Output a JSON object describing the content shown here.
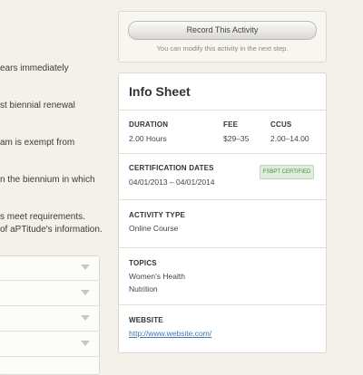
{
  "left": {
    "text_lines": [
      "ears immediately",
      "st biennial renewal",
      "am is exempt from",
      "n the biennium in which",
      "s meet requirements.",
      " of aPTitude's information."
    ]
  },
  "record": {
    "button_label": "Record This Activity",
    "note": "You can modify this activity in the next step."
  },
  "info": {
    "title": "Info Sheet",
    "duration_label": "DURATION",
    "duration_value": "2.00 Hours",
    "fee_label": "FEE",
    "fee_value": "$29–35",
    "ccus_label": "CCUS",
    "ccus_value": "2.00–14.00",
    "cert_label": "CERTIFICATION DATES",
    "cert_value": "04/01/2013 – 04/01/2014",
    "badge": "FSBPT CERTIFIED",
    "type_label": "ACTIVITY TYPE",
    "type_value": "Online Course",
    "topics_label": "TOPICS",
    "topics": [
      "Women's Health",
      "Nutrition"
    ],
    "website_label": "WEBSITE",
    "website_value": "http://www.website.com/"
  },
  "colors": {
    "badge_bg": "#dfeedc",
    "link": "#3b78b5",
    "background": "#f3f1ea"
  }
}
